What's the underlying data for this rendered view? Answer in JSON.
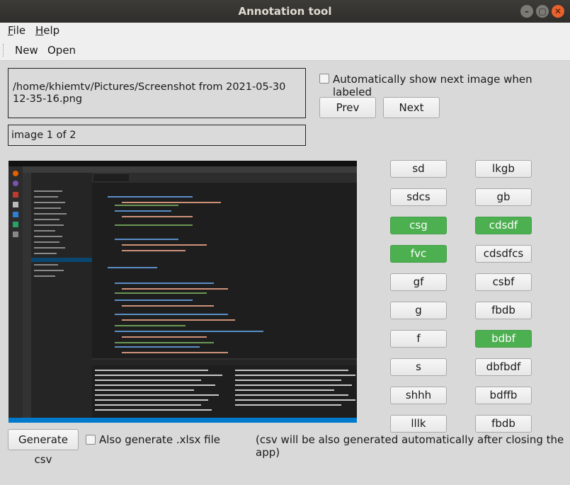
{
  "window": {
    "title": "Annotation tool",
    "controls": [
      "–",
      "▢",
      "✕"
    ]
  },
  "menu": {
    "file": "File",
    "help": "Help"
  },
  "toolbar": {
    "new": "New",
    "open": "Open"
  },
  "image_info": {
    "path_line1": "/home/khiemtv/Pictures/Screenshot from 2021-05-30",
    "path_line2": "12-35-16.png",
    "counter": "image 1 of 2"
  },
  "options": {
    "auto_next_label": "Automatically show next image when labeled",
    "auto_next_checked": false,
    "xlsx_label": "Also generate .xlsx file",
    "xlsx_checked": false
  },
  "nav": {
    "prev": "Prev",
    "next": "Next"
  },
  "labels": [
    {
      "text": "sd",
      "active": false
    },
    {
      "text": "lkgb",
      "active": false
    },
    {
      "text": "sdcs",
      "active": false
    },
    {
      "text": "gb",
      "active": false
    },
    {
      "text": "csg",
      "active": true
    },
    {
      "text": "cdsdf",
      "active": true
    },
    {
      "text": "fvc",
      "active": true
    },
    {
      "text": "cdsdfcs",
      "active": false
    },
    {
      "text": "gf",
      "active": false
    },
    {
      "text": "csbf",
      "active": false
    },
    {
      "text": "g",
      "active": false
    },
    {
      "text": "fbdb",
      "active": false
    },
    {
      "text": "f",
      "active": false
    },
    {
      "text": "bdbf",
      "active": true
    },
    {
      "text": "s",
      "active": false
    },
    {
      "text": "dbfbdf",
      "active": false
    },
    {
      "text": "shhh",
      "active": false
    },
    {
      "text": "bdffb",
      "active": false
    },
    {
      "text": "lllk",
      "active": false
    },
    {
      "text": "fbdb",
      "active": false
    }
  ],
  "actions": {
    "generate_csv": "Generate csv",
    "note": "(csv will be also generated automatically after closing the app)"
  },
  "colors": {
    "active_label": "#4caf50",
    "titlebar": "#3c3b37",
    "close_button": "#e9622c"
  }
}
